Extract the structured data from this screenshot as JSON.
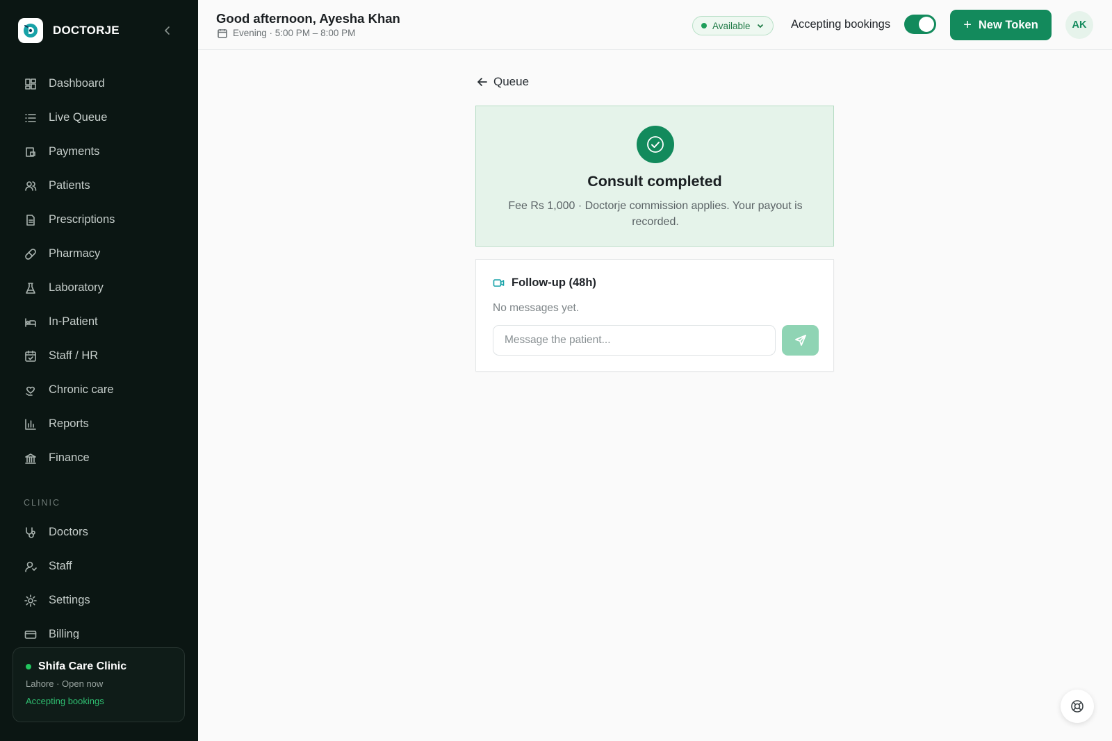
{
  "brand": {
    "name": "DOCTORJE"
  },
  "sidebar": {
    "items": [
      {
        "label": "Dashboard",
        "icon": "dashboard-icon"
      },
      {
        "label": "Live Queue",
        "icon": "list-icon"
      },
      {
        "label": "Payments",
        "icon": "wallet-icon"
      },
      {
        "label": "Patients",
        "icon": "users-icon"
      },
      {
        "label": "Prescriptions",
        "icon": "file-icon"
      },
      {
        "label": "Pharmacy",
        "icon": "pill-icon"
      },
      {
        "label": "Laboratory",
        "icon": "flask-icon"
      },
      {
        "label": "In-Patient",
        "icon": "bed-icon"
      },
      {
        "label": "Staff / HR",
        "icon": "calendar-check-icon"
      },
      {
        "label": "Chronic care",
        "icon": "heart-hand-icon"
      },
      {
        "label": "Reports",
        "icon": "bar-chart-icon"
      },
      {
        "label": "Finance",
        "icon": "bank-icon"
      }
    ],
    "section_label": "CLINIC",
    "clinic_items": [
      {
        "label": "Doctors",
        "icon": "stethoscope-icon"
      },
      {
        "label": "Staff",
        "icon": "user-icon"
      },
      {
        "label": "Settings",
        "icon": "gear-icon"
      },
      {
        "label": "Billing",
        "icon": "credit-card-icon"
      }
    ],
    "clinic_card": {
      "name": "Shifa Care Clinic",
      "subtitle": "Lahore · Open now",
      "status": "Accepting bookings"
    }
  },
  "header": {
    "greeting": "Good afternoon, Ayesha Khan",
    "shift": "Evening · 5:00 PM – 8:00 PM",
    "availability": "Available",
    "accepting_label": "Accepting bookings",
    "accepting_on": true,
    "new_token_label": "New Token",
    "avatar_initials": "AK"
  },
  "main": {
    "back_label": "Queue",
    "completed": {
      "title": "Consult completed",
      "description": "Fee Rs 1,000 · Doctorje commission applies. Your payout is recorded."
    },
    "follow_up": {
      "title": "Follow-up (48h)",
      "empty_text": "No messages yet.",
      "input_placeholder": "Message the patient..."
    }
  },
  "colors": {
    "sidebar_bg": "#0b1613",
    "brand_green": "#138a5c",
    "success_bg": "#e5f3ea",
    "send_disabled": "#8fd4b4"
  }
}
